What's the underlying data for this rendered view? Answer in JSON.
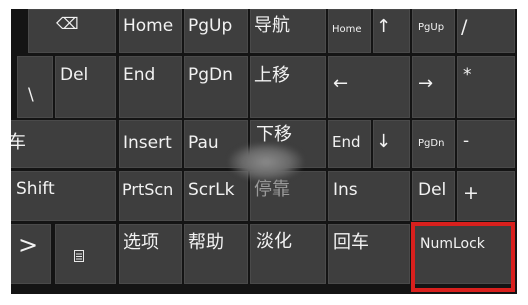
{
  "keyboard": {
    "row1": {
      "backspace_icon": "⌫",
      "home": "Home",
      "pgup": "PgUp",
      "nav": "导航",
      "num_home": "Home",
      "num_up": "↑",
      "num_pgup": "PgUp",
      "num_slash": "/"
    },
    "row2": {
      "backslash": "\\",
      "del": "Del",
      "end": "End",
      "pgdn": "PgDn",
      "move_up": "上移",
      "num_left": "←",
      "num_right": "→",
      "num_star": "*"
    },
    "row3": {
      "enter_partial": "车",
      "insert": "Insert",
      "pause_partial": "Pau",
      "move_partial": "下移",
      "num_end": "End",
      "num_down": "↓",
      "num_pgdn": "PgDn",
      "num_minus": "-"
    },
    "row4": {
      "shift": "Shift",
      "prtscn": "PrtScn",
      "scrlk": "ScrLk",
      "dock": "停靠",
      "ins": "Ins",
      "num_del": "Del",
      "num_plus": "+"
    },
    "row5": {
      "right_chevron": ">",
      "menu_icon": "menu-icon",
      "options": "选项",
      "help": "帮助",
      "fade": "淡化",
      "enter": "回车",
      "numlock": "NumLock"
    }
  },
  "colors": {
    "key_bg": "#3e3e3e",
    "key_text": "#f2f2f2",
    "frame_bg": "#141414",
    "highlight": "#d9201d"
  }
}
